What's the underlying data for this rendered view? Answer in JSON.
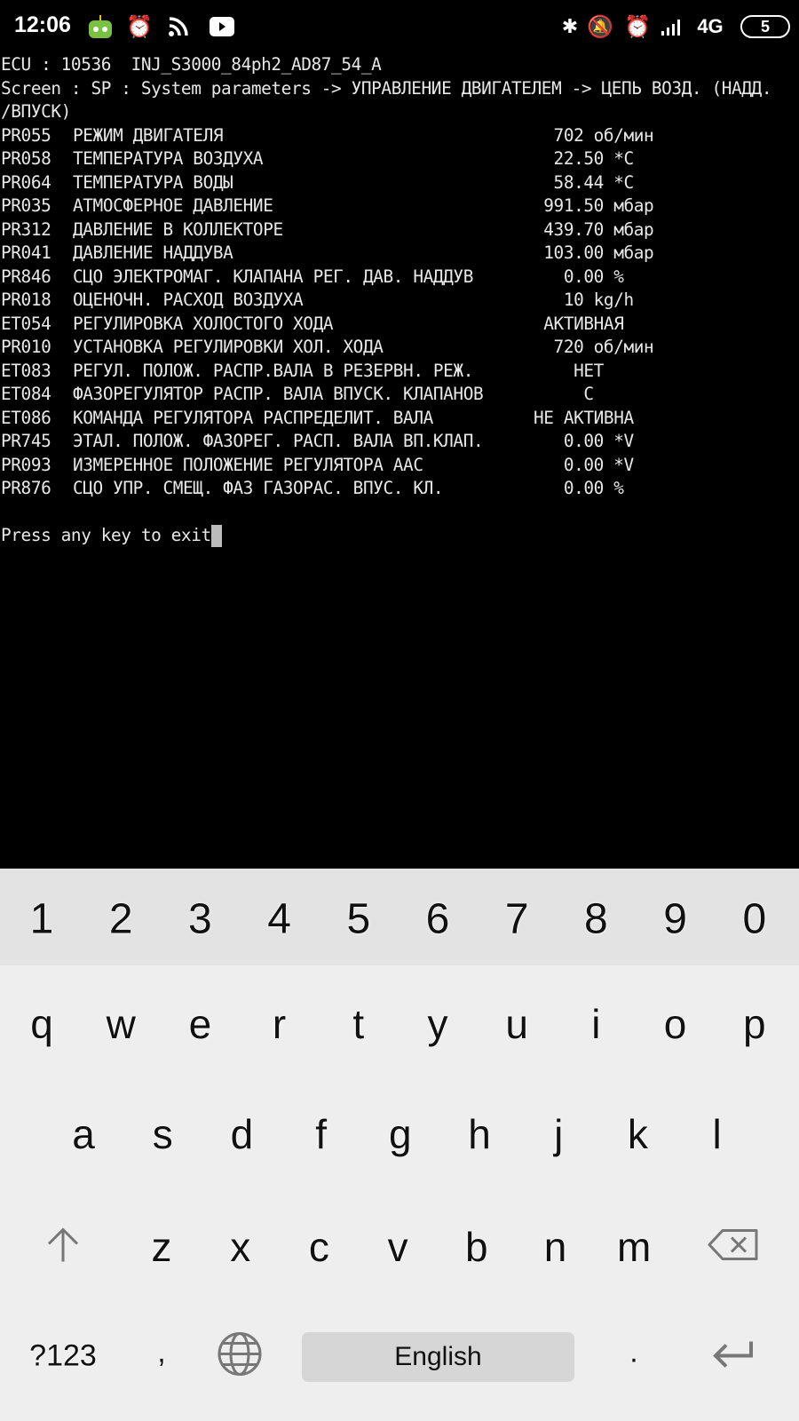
{
  "status_bar": {
    "time": "12:06",
    "network": "4G",
    "battery": "5",
    "icons_left": [
      "duolingo-app-icon",
      "alarm-icon",
      "rss-icon",
      "youtube-icon"
    ],
    "icons_right": [
      "bluetooth-icon",
      "mute-icon",
      "alarm-icon",
      "signal-icon",
      "4g-icon",
      "battery-icon"
    ]
  },
  "terminal": {
    "header": [
      "ECU : 10536  INJ_S3000_84ph2_AD87_54_A",
      "Screen : SP : System parameters -> УПРАВЛЕНИЕ ДВИГАТЕЛЕМ -> ЦЕПЬ ВОЗД. (НАДД.",
      "/ВПУСК)"
    ],
    "rows": [
      {
        "code": "PR055",
        "name": "РЕЖИМ ДВИГАТЕЛЯ",
        "value": "  702 об/мин"
      },
      {
        "code": "PR058",
        "name": "ТЕМПЕРАТУРА ВОЗДУХА",
        "value": "  22.50 *C"
      },
      {
        "code": "PR064",
        "name": "ТЕМПЕРАТУРА ВОДЫ",
        "value": "  58.44 *C"
      },
      {
        "code": "PR035",
        "name": "АТМОСФЕРНОЕ ДАВЛЕНИЕ",
        "value": " 991.50 мбар"
      },
      {
        "code": "PR312",
        "name": "ДАВЛЕНИЕ В КОЛЛЕКТОРЕ",
        "value": " 439.70 мбар"
      },
      {
        "code": "PR041",
        "name": "ДАВЛЕНИЕ НАДДУВА",
        "value": " 103.00 мбар"
      },
      {
        "code": "PR846",
        "name": "СЦО ЭЛЕКТРОМАГ. КЛАПАНА РЕГ. ДАВ. НАДДУВ",
        "value": "   0.00 %"
      },
      {
        "code": "PR018",
        "name": "ОЦЕНОЧН. РАСХОД ВОЗДУХА",
        "value": "   10 kg/h"
      },
      {
        "code": "ET054",
        "name": "РЕГУЛИРОВКА ХОЛОСТОГО ХОДА",
        "value": " АКТИВНАЯ"
      },
      {
        "code": "PR010",
        "name": "УСТАНОВКА РЕГУЛИРОВКИ ХОЛ. ХОДА",
        "value": "  720 об/мин"
      },
      {
        "code": "ET083",
        "name": "РЕГУЛ. ПОЛОЖ. РАСПР.ВАЛА В РЕЗЕРВН. РЕЖ.",
        "value": "    НЕТ"
      },
      {
        "code": "ET084",
        "name": "ФАЗОРЕГУЛЯТОР РАСПР. ВАЛА ВПУСК. КЛАПАНОВ",
        "value": "     С"
      },
      {
        "code": "ET086",
        "name": "КОМАНДА РЕГУЛЯТОРА РАСПРЕДЕЛИТ. ВАЛА",
        "value": "НЕ АКТИВНА"
      },
      {
        "code": "PR745",
        "name": "ЭТАЛ. ПОЛОЖ. ФАЗОРЕГ. РАСП. ВАЛА ВП.КЛАП.",
        "value": "   0.00 *V"
      },
      {
        "code": "PR093",
        "name": "ИЗМЕРЕННОЕ ПОЛОЖЕНИЕ РЕГУЛЯТОРА ААС",
        "value": "   0.00 *V"
      },
      {
        "code": "PR876",
        "name": "СЦО УПР. СМЕЩ. ФАЗ ГАЗОРАС. ВПУС. КЛ.",
        "value": "   0.00 %"
      }
    ],
    "prompt": "Press any key to exit"
  },
  "keyboard": {
    "numbers": [
      "1",
      "2",
      "3",
      "4",
      "5",
      "6",
      "7",
      "8",
      "9",
      "0"
    ],
    "row1": [
      "q",
      "w",
      "e",
      "r",
      "t",
      "y",
      "u",
      "i",
      "o",
      "p"
    ],
    "row2": [
      "a",
      "s",
      "d",
      "f",
      "g",
      "h",
      "j",
      "k",
      "l"
    ],
    "row3": [
      "z",
      "x",
      "c",
      "v",
      "b",
      "n",
      "m"
    ],
    "symbols": "?123",
    "comma": ",",
    "space": "English",
    "period": "."
  }
}
